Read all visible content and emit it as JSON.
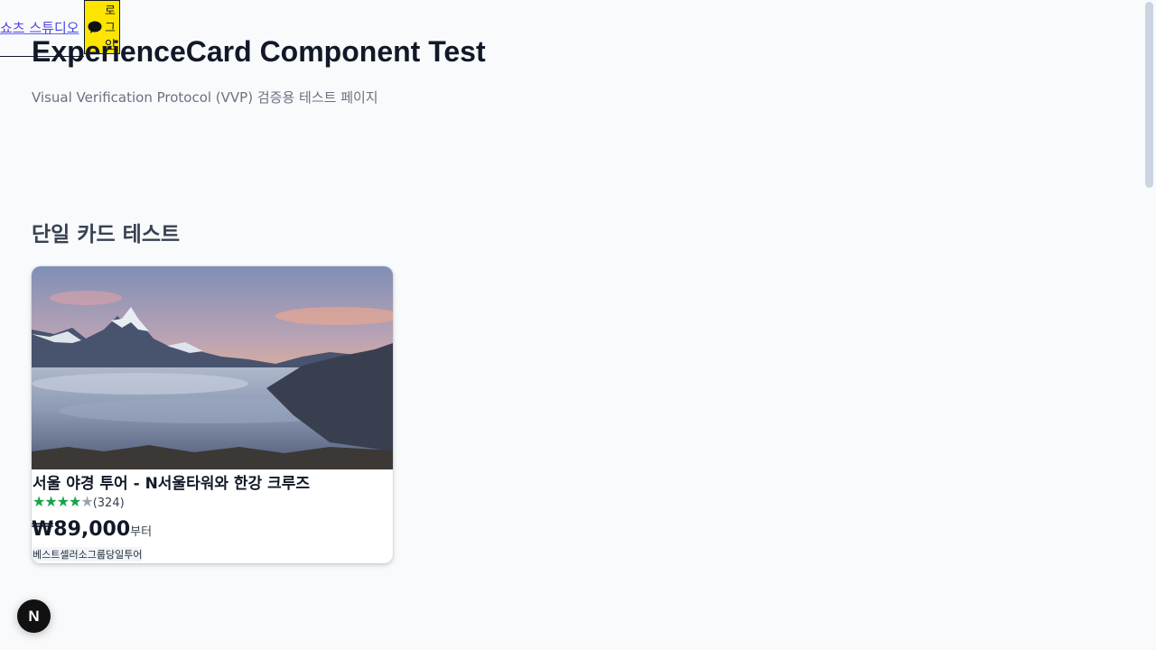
{
  "nav": {
    "link_label": "쇼츠 스튜디오",
    "login_icon": "chat-bubble-icon",
    "login_label": "로그인",
    "login_color": "#fee500"
  },
  "page": {
    "title": "ExperienceCard Component Test",
    "subtitle": "Visual Verification Protocol (VVP) 검증용 테스트 페이지"
  },
  "section": {
    "title": "단일 카드 테스트"
  },
  "card": {
    "image": "mountain-sea-of-clouds-sunset",
    "title": "서울 야경 투어 - N서울타워와 한강 크루즈",
    "rating": {
      "stars_filled": 4,
      "stars_total": 5,
      "star_color": "#16a34a",
      "review_count": "(324)"
    },
    "price": "₩89,000",
    "price_suffix": "부터",
    "tags": "베스트셀러소그룹당일투어"
  },
  "badge": {
    "label": "N",
    "icon": "nextjs-dev-indicator-icon"
  }
}
